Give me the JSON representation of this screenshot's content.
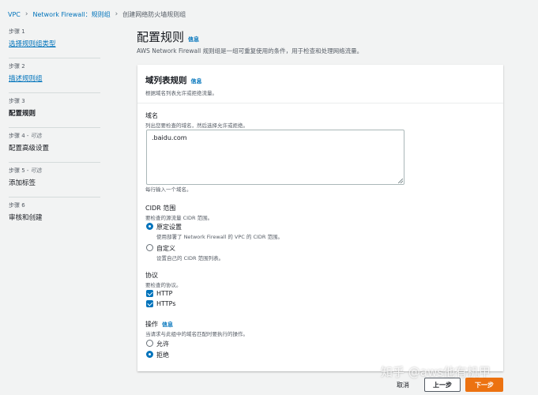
{
  "breadcrumb": {
    "items": [
      "VPC",
      "Network Firewall：规则组",
      "创建网络防火墙规则组"
    ]
  },
  "steps": [
    {
      "num": "步骤 1",
      "title": "选择规则组类型"
    },
    {
      "num": "步骤 2",
      "title": "描述规则组"
    },
    {
      "num": "步骤 3",
      "title": "配置规则"
    },
    {
      "num": "步骤 4 -",
      "optional": "可选",
      "title": "配置高级设置"
    },
    {
      "num": "步骤 5 -",
      "optional": "可选",
      "title": "添加标签"
    },
    {
      "num": "步骤 6",
      "title": "审核和创建"
    }
  ],
  "page": {
    "title": "配置规则",
    "info": "信息",
    "description": "AWS Network Firewall 规则组是一组可重复使用的条件，用于检查和处理网络流量。"
  },
  "panel": {
    "title": "域列表规则",
    "info": "信息",
    "description": "根据域名列表允许或拒绝流量。"
  },
  "domain": {
    "label": "域名",
    "description": "列出您要检查的域名，然后选择允许或拒绝。",
    "value": ".baidu.com",
    "hint": "每行输入一个域名。"
  },
  "cidr": {
    "label": "CIDR 范围",
    "description": "要检查的源流量 CIDR 范围。",
    "options": [
      {
        "label": "原定设置",
        "description": "使用部署了 Network Firewall 的 VPC 的 CIDR 范围。",
        "checked": true
      },
      {
        "label": "自定义",
        "description": "设置自己的 CIDR 范围列表。",
        "checked": false
      }
    ]
  },
  "protocol": {
    "label": "协议",
    "description": "要检查的协议。",
    "options": [
      {
        "label": "HTTP",
        "checked": true
      },
      {
        "label": "HTTPs",
        "checked": true
      }
    ]
  },
  "action": {
    "label": "操作",
    "info": "信息",
    "description": "当请求与此组中的域名匹配时要执行的操作。",
    "options": [
      {
        "label": "允许",
        "checked": false
      },
      {
        "label": "拒绝",
        "checked": true
      }
    ]
  },
  "footer": {
    "cancel": "取消",
    "previous": "上一步",
    "next": "下一步"
  },
  "watermark": "知乎 @aws他有机甲",
  "colors": {
    "link": "#0073bb",
    "primary_button": "#ec7211",
    "background": "#f2f3f3"
  }
}
